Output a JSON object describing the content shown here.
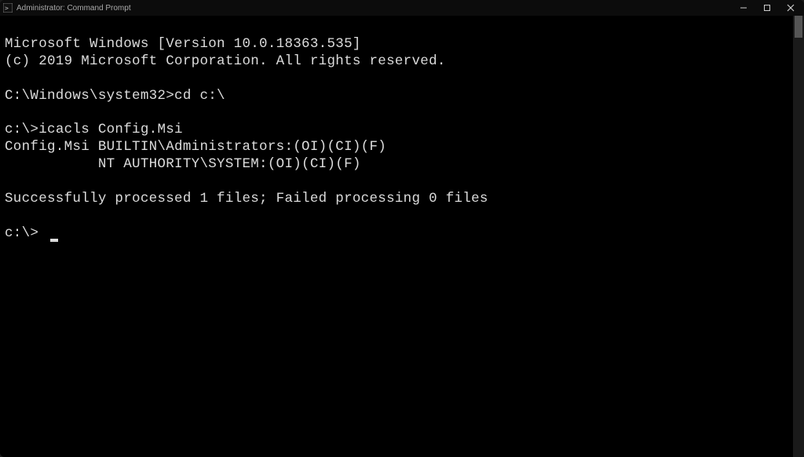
{
  "window": {
    "title": "Administrator: Command Prompt"
  },
  "terminal": {
    "header1": "Microsoft Windows [Version 10.0.18363.535]",
    "header2": "(c) 2019 Microsoft Corporation. All rights reserved.",
    "blank1": "",
    "line_cd_prompt": "C:\\Windows\\system32>",
    "line_cd_cmd": "cd c:\\",
    "blank2": "",
    "line_icacls_prompt": "c:\\>",
    "line_icacls_cmd": "icacls Config.Msi",
    "out1": "Config.Msi BUILTIN\\Administrators:(OI)(CI)(F)",
    "out2": "           NT AUTHORITY\\SYSTEM:(OI)(CI)(F)",
    "blank3": "",
    "out3": "Successfully processed 1 files; Failed processing 0 files",
    "blank4": "",
    "final_prompt": "c:\\> "
  }
}
